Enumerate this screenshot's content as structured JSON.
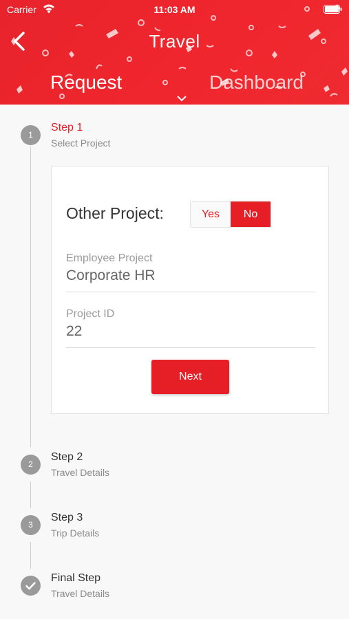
{
  "status_bar": {
    "carrier": "Carrier",
    "time": "11:03 AM"
  },
  "header": {
    "title": "Travel",
    "tabs": [
      {
        "label": "Request"
      },
      {
        "label": "Dashboard"
      }
    ]
  },
  "steps": [
    {
      "number": "1",
      "title": "Step 1",
      "subtitle": "Select Project",
      "active": true
    },
    {
      "number": "2",
      "title": "Step 2",
      "subtitle": "Travel Details"
    },
    {
      "number": "3",
      "title": "Step 3",
      "subtitle": "Trip Details"
    },
    {
      "number": "",
      "title": "Final Step",
      "subtitle": "Travel Details",
      "icon": "check-icon"
    }
  ],
  "form": {
    "other_project_label": "Other Project:",
    "toggle": {
      "yes": "Yes",
      "no": "No",
      "selected": "No"
    },
    "employee_project": {
      "label": "Employee Project",
      "value": "Corporate HR"
    },
    "project_id": {
      "label": "Project ID",
      "value": "22"
    },
    "next_label": "Next"
  },
  "colors": {
    "accent": "#e61e26",
    "header": "#ee2a2f",
    "step_inactive": "#9a9a9a"
  }
}
